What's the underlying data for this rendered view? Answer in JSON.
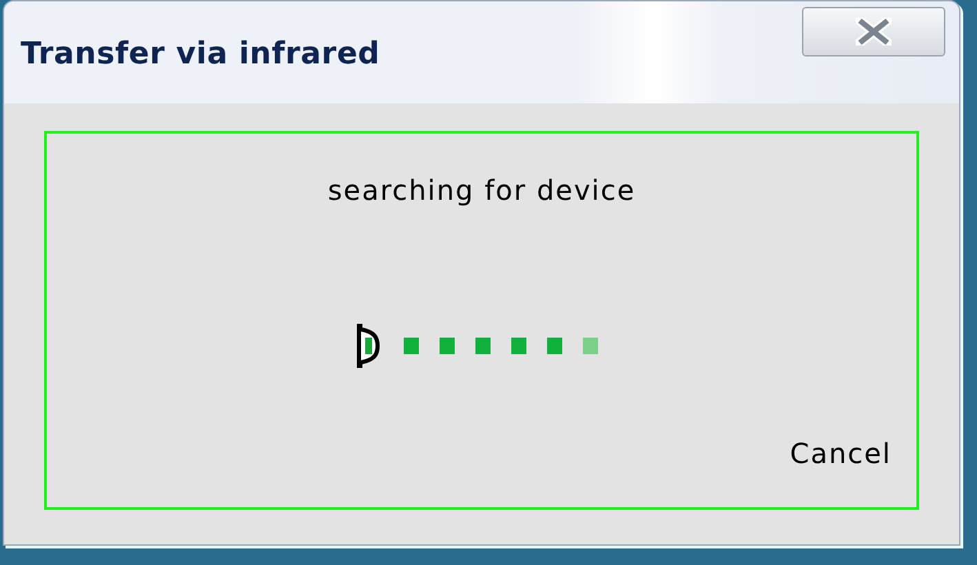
{
  "window": {
    "title": "Transfer via infrared"
  },
  "status": "searching for device",
  "dots": [
    {
      "lit": true
    },
    {
      "lit": true
    },
    {
      "lit": true
    },
    {
      "lit": true
    },
    {
      "lit": true
    },
    {
      "lit": false
    }
  ],
  "cancel": "Cancel"
}
